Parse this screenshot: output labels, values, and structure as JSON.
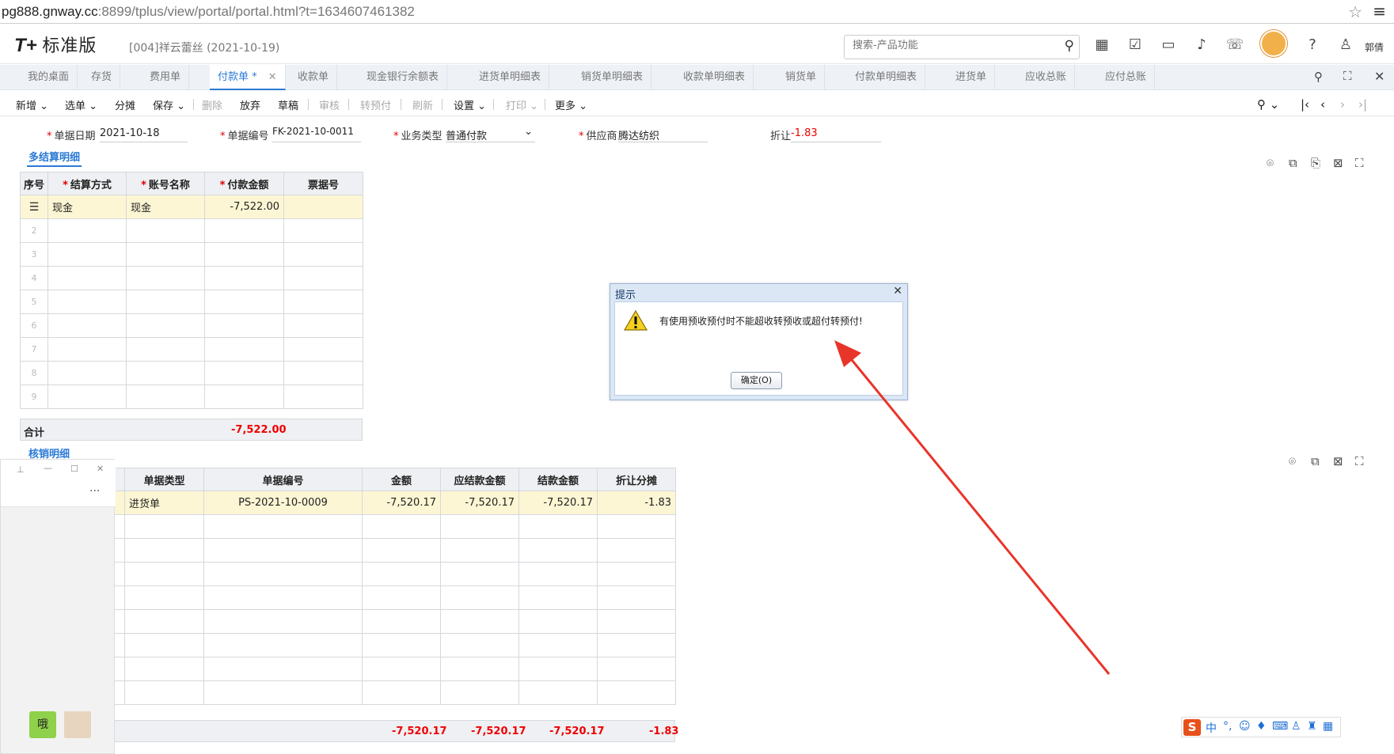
{
  "browser": {
    "url_host": "pg888.gnway.cc",
    "url_rest": ":8899/tplus/view/portal/portal.html?t=1634607461382"
  },
  "header": {
    "logo_t": "T+",
    "logo_text": "标准版",
    "company": "[004]祥云蕾丝   (2021-10-19)",
    "search_placeholder": "搜索-产品功能",
    "user": "郭倩"
  },
  "tabs": [
    {
      "label": "我的桌面"
    },
    {
      "label": "存货"
    },
    {
      "label": "费用单"
    },
    {
      "label": "付款单 *"
    },
    {
      "label": "收款单"
    },
    {
      "label": "现金银行余额表"
    },
    {
      "label": "进货单明细表"
    },
    {
      "label": "销货单明细表"
    },
    {
      "label": "收款单明细表"
    },
    {
      "label": "销货单"
    },
    {
      "label": "付款单明细表"
    },
    {
      "label": "进货单"
    },
    {
      "label": "应收总账"
    },
    {
      "label": "应付总账"
    }
  ],
  "toolbar": {
    "new": "新增",
    "select": "选单",
    "split": "分摊",
    "save": "保存",
    "delete": "删除",
    "discard": "放弃",
    "draft": "草稿",
    "audit": "审核",
    "to_prepay": "转预付",
    "refresh": "刷新",
    "settings": "设置",
    "print": "打印",
    "more": "更多"
  },
  "form": {
    "date_label": "单据日期",
    "date_value": "2021-10-18",
    "code_label": "单据编号",
    "code_value": "FK-2021-10-0011",
    "biz_label": "业务类型",
    "biz_value": "普通付款",
    "supplier_label": "供应商",
    "supplier_value": "腾达纺织",
    "discount_label": "折让",
    "discount_value": "-1.83"
  },
  "settlement": {
    "title": "多结算明细",
    "headers": [
      "序号",
      "结算方式",
      "账号名称",
      "付款金额",
      "票据号"
    ],
    "rows": [
      [
        "",
        "现金",
        "现金",
        "-7,522.00",
        ""
      ],
      [
        "2",
        "",
        "",
        "",
        ""
      ],
      [
        "3",
        "",
        "",
        "",
        ""
      ],
      [
        "4",
        "",
        "",
        "",
        ""
      ],
      [
        "5",
        "",
        "",
        "",
        ""
      ],
      [
        "6",
        "",
        "",
        "",
        ""
      ],
      [
        "7",
        "",
        "",
        "",
        ""
      ],
      [
        "8",
        "",
        "",
        "",
        ""
      ],
      [
        "9",
        "",
        "",
        "",
        ""
      ]
    ],
    "sum_label": "合计",
    "sum_value": "-7,522.00"
  },
  "writeoff": {
    "title": "核销明细",
    "headers": [
      "单据类型",
      "单据编号",
      "金额",
      "应结款金额",
      "结款金额",
      "折让分摊"
    ],
    "rows": [
      [
        "进货单",
        "PS-2021-10-0009",
        "-7,520.17",
        "-7,520.17",
        "-7,520.17",
        "-1.83"
      ]
    ],
    "sums": [
      "-7,520.17",
      "-7,520.17",
      "-7,520.17",
      "-1.83"
    ]
  },
  "dialog": {
    "title": "提示",
    "message": "有使用预收预付时不能超收转预收或超付转预付!",
    "ok": "确定(O)"
  },
  "chat": {
    "bubble": "哦",
    "dots": "..."
  },
  "ime": {
    "logo": "S",
    "mode": "中"
  },
  "colors": {
    "accent": "#2a7ad5",
    "negative": "#e00000",
    "arrow": "#e8352a"
  }
}
